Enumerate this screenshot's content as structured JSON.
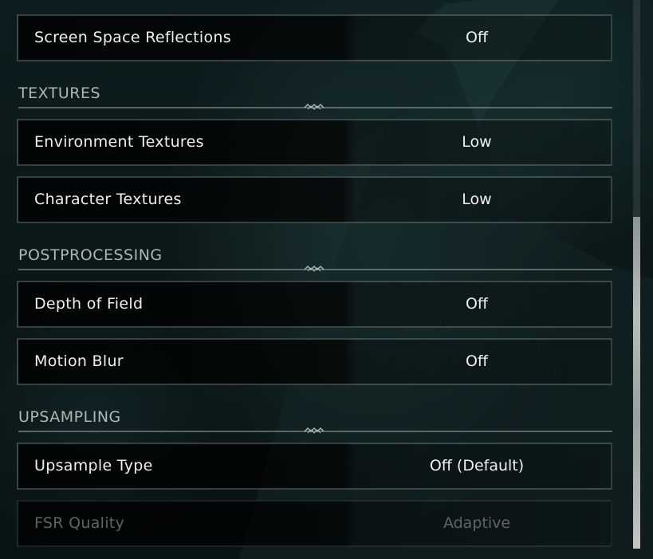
{
  "settings": {
    "screen_space_reflections": {
      "label": "Screen Space Reflections",
      "value": "Off"
    },
    "environment_textures": {
      "label": "Environment Textures",
      "value": "Low"
    },
    "character_textures": {
      "label": "Character Textures",
      "value": "Low"
    },
    "depth_of_field": {
      "label": "Depth of Field",
      "value": "Off"
    },
    "motion_blur": {
      "label": "Motion Blur",
      "value": "Off"
    },
    "upsample_type": {
      "label": "Upsample Type",
      "value": "Off (Default)"
    },
    "fsr_quality": {
      "label": "FSR Quality",
      "value": "Adaptive"
    }
  },
  "sections": {
    "textures": "TEXTURES",
    "postprocessing": "POSTPROCESSING",
    "upsampling": "UPSAMPLING"
  },
  "icons": {
    "section_ornament": "ornament-icon"
  },
  "scrollbar": {
    "position_fraction": 0.6
  }
}
